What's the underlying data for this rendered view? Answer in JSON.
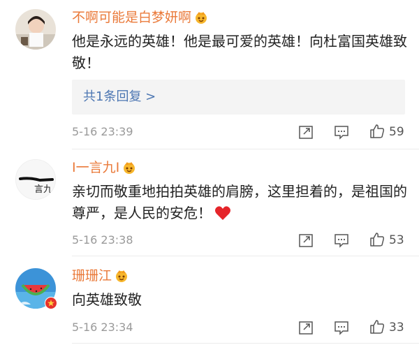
{
  "comments": [
    {
      "username": "不啊可能是白梦妍啊",
      "text": "他是永远的英雄！他是最可爱的英雄！向杜富国英雄致敬！",
      "reply_summary": "共1条回复 >",
      "time": "5-16 23:39",
      "likes": "59",
      "icons": [
        "avatar-photo",
        "crown-icon",
        "share-icon",
        "comment-icon",
        "like-icon"
      ]
    },
    {
      "username": "I一言九I",
      "text": "亲切而敬重地拍拍英雄的肩膀，这里担着的，是祖国的尊严，是人民的安危！",
      "emoji": "heart-emoji",
      "time": "5-16 23:38",
      "likes": "53",
      "icons": [
        "avatar-calligraphy",
        "crown-icon",
        "share-icon",
        "comment-icon",
        "like-icon"
      ]
    },
    {
      "username": "珊珊江",
      "text": "向英雄致敬",
      "time": "5-16 23:34",
      "likes": "33",
      "icons": [
        "avatar-watermelon",
        "crown-icon",
        "flag-badge-icon",
        "share-icon",
        "comment-icon",
        "like-icon"
      ]
    }
  ],
  "colors": {
    "username": "#ea7a3a",
    "link": "#4c76b2",
    "time": "#9a9a9a",
    "heart": "#e5252a"
  }
}
